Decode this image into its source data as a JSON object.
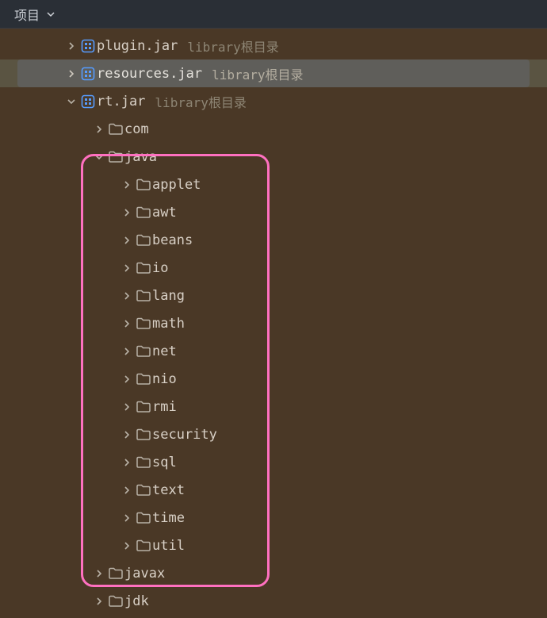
{
  "header": {
    "title": "项目"
  },
  "hint_label": "library根目录",
  "jars": [
    {
      "name": "plugin.jar",
      "expanded": false,
      "selected": false
    },
    {
      "name": "resources.jar",
      "expanded": false,
      "selected": true
    },
    {
      "name": "rt.jar",
      "expanded": true,
      "selected": false
    }
  ],
  "rt_children": [
    {
      "name": "com",
      "expanded": false
    },
    {
      "name": "java",
      "expanded": true
    },
    {
      "name": "javax",
      "expanded": false
    },
    {
      "name": "jdk",
      "expanded": false
    }
  ],
  "java_children": [
    {
      "name": "applet"
    },
    {
      "name": "awt"
    },
    {
      "name": "beans"
    },
    {
      "name": "io"
    },
    {
      "name": "lang"
    },
    {
      "name": "math"
    },
    {
      "name": "net"
    },
    {
      "name": "nio"
    },
    {
      "name": "rmi"
    },
    {
      "name": "security"
    },
    {
      "name": "sql"
    },
    {
      "name": "text"
    },
    {
      "name": "time"
    },
    {
      "name": "util"
    }
  ]
}
